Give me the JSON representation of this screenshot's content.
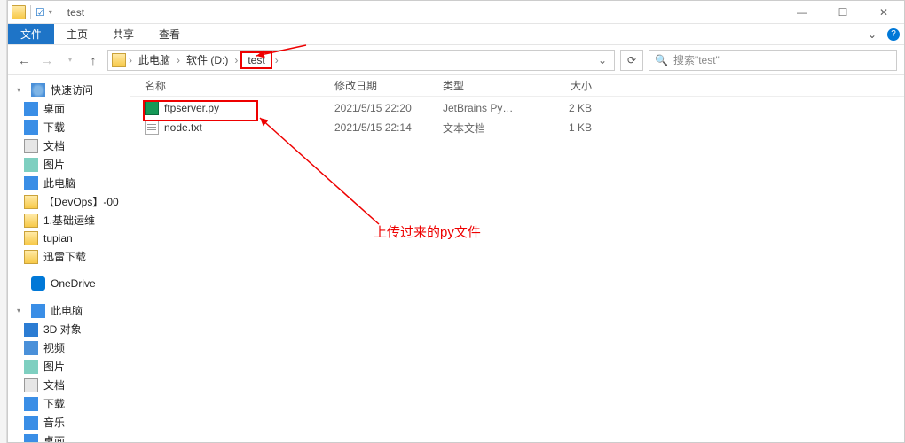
{
  "title": "test",
  "ribbon": {
    "file": "文件",
    "home": "主页",
    "share": "共享",
    "view": "查看"
  },
  "breadcrumb": {
    "pc": "此电脑",
    "drive": "软件 (D:)",
    "folder": "test"
  },
  "search": {
    "placeholder": "搜索\"test\""
  },
  "columns": {
    "name": "名称",
    "date": "修改日期",
    "type": "类型",
    "size": "大小"
  },
  "files": [
    {
      "name": "ftpserver.py",
      "date": "2021/5/15 22:20",
      "type": "JetBrains PyChar...",
      "size": "2 KB"
    },
    {
      "name": "node.txt",
      "date": "2021/5/15 22:14",
      "type": "文本文档",
      "size": "1 KB"
    }
  ],
  "sidebar": {
    "quick": "快速访问",
    "desktop": "桌面",
    "downloads": "下载",
    "documents": "文档",
    "pictures": "图片",
    "thispc": "此电脑",
    "devops": "【DevOps】-00",
    "basic": "1.基础运维",
    "tupian": "tupian",
    "xunlei": "迅雷下载",
    "onedrive": "OneDrive",
    "thispc2": "此电脑",
    "threed": "3D 对象",
    "video": "视频",
    "pictures2": "图片",
    "documents2": "文档",
    "downloads2": "下载",
    "music": "音乐",
    "desktop2": "桌面"
  },
  "annotation": "上传过来的py文件"
}
